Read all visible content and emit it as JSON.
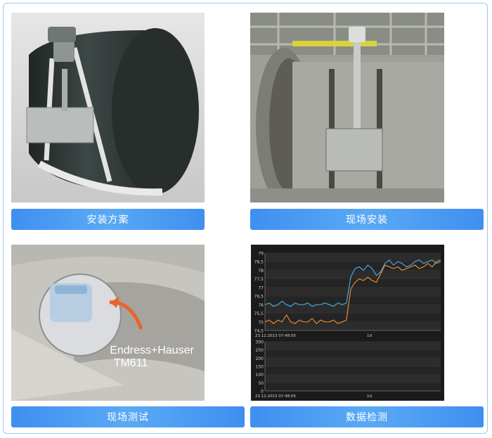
{
  "cells": [
    {
      "caption": "安装方案"
    },
    {
      "caption": "现场安装"
    },
    {
      "caption": "现场测试",
      "overlay_line1": "Endress+Hauser",
      "overlay_line2": "TM611"
    },
    {
      "caption": "数据检测"
    }
  ],
  "chart_data": [
    {
      "type": "line",
      "y_ticks": [
        "79",
        "78,5",
        "78",
        "77,5",
        "77",
        "76,5",
        "76",
        "75,5",
        "75",
        "74,5"
      ],
      "ylim": [
        74.5,
        79
      ],
      "x_left_label": "23.12.2023 07:48:05",
      "x_mid_label": "1d",
      "series": [
        {
          "color": "#45a6e0",
          "values": [
            76.0,
            76.1,
            75.9,
            76.0,
            76.2,
            76.0,
            75.9,
            76.1,
            76.0,
            76.0,
            76.1,
            75.9,
            76.0,
            76.0,
            76.1,
            76.0,
            75.9,
            76.1,
            76.0,
            76.1,
            77.6,
            78.1,
            78.2,
            78.0,
            78.3,
            78.1,
            77.7,
            77.9,
            78.4,
            78.6,
            78.3,
            78.5,
            78.4,
            78.2,
            78.3,
            78.5,
            78.6,
            78.4,
            78.5,
            78.6,
            78.4,
            78.5
          ]
        },
        {
          "color": "#e8892e",
          "values": [
            75.0,
            75.1,
            74.9,
            75.1,
            75.0,
            75.4,
            75.0,
            74.9,
            75.1,
            75.0,
            75.0,
            75.2,
            74.9,
            75.1,
            75.0,
            75.0,
            75.1,
            74.9,
            75.0,
            75.1,
            76.9,
            77.3,
            77.5,
            77.4,
            77.6,
            77.4,
            77.3,
            77.8,
            78.3,
            78.2,
            78.1,
            78.2,
            78.0,
            78.1,
            78.2,
            78.3,
            78.1,
            78.2,
            78.4,
            78.2,
            78.5,
            78.6
          ]
        }
      ]
    },
    {
      "type": "line",
      "y_ticks": [
        "300",
        "250",
        "200",
        "150",
        "100",
        "50",
        "0"
      ],
      "ylim": [
        0,
        300
      ],
      "x_left_label": "23.12.2023 07:48:05",
      "x_mid_label": "1d",
      "series": []
    }
  ]
}
